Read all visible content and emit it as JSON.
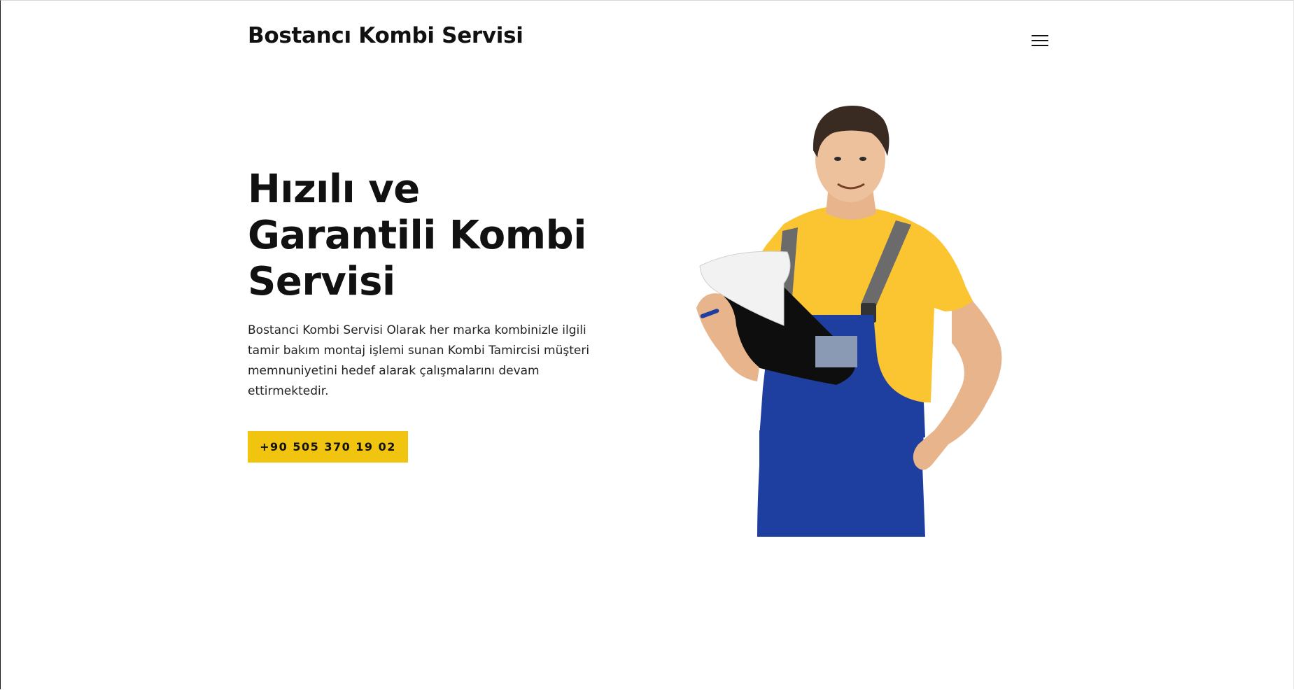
{
  "header": {
    "brand": "Bostancı Kombi Servisi",
    "menu_icon": "hamburger-menu-icon"
  },
  "hero": {
    "title_lines": [
      "Hızılı ve",
      "Garantili Kombi",
      "Servisi"
    ],
    "description": "Bostanci Kombi Servisi Olarak her marka kombinizle ilgili tamir bakım montaj işlemi sunan Kombi Tamircisi müşteri memnuniyetini hedef alarak çalışmalarını devam ettirmektedir.",
    "cta_label": "+90 505 370 19 02",
    "image_subject": "technician-with-clipboard"
  },
  "colors": {
    "accent": "#f1c40f",
    "text": "#111111",
    "background": "#ffffff",
    "shirt": "#fbc531",
    "overalls": "#1f3fa0"
  }
}
